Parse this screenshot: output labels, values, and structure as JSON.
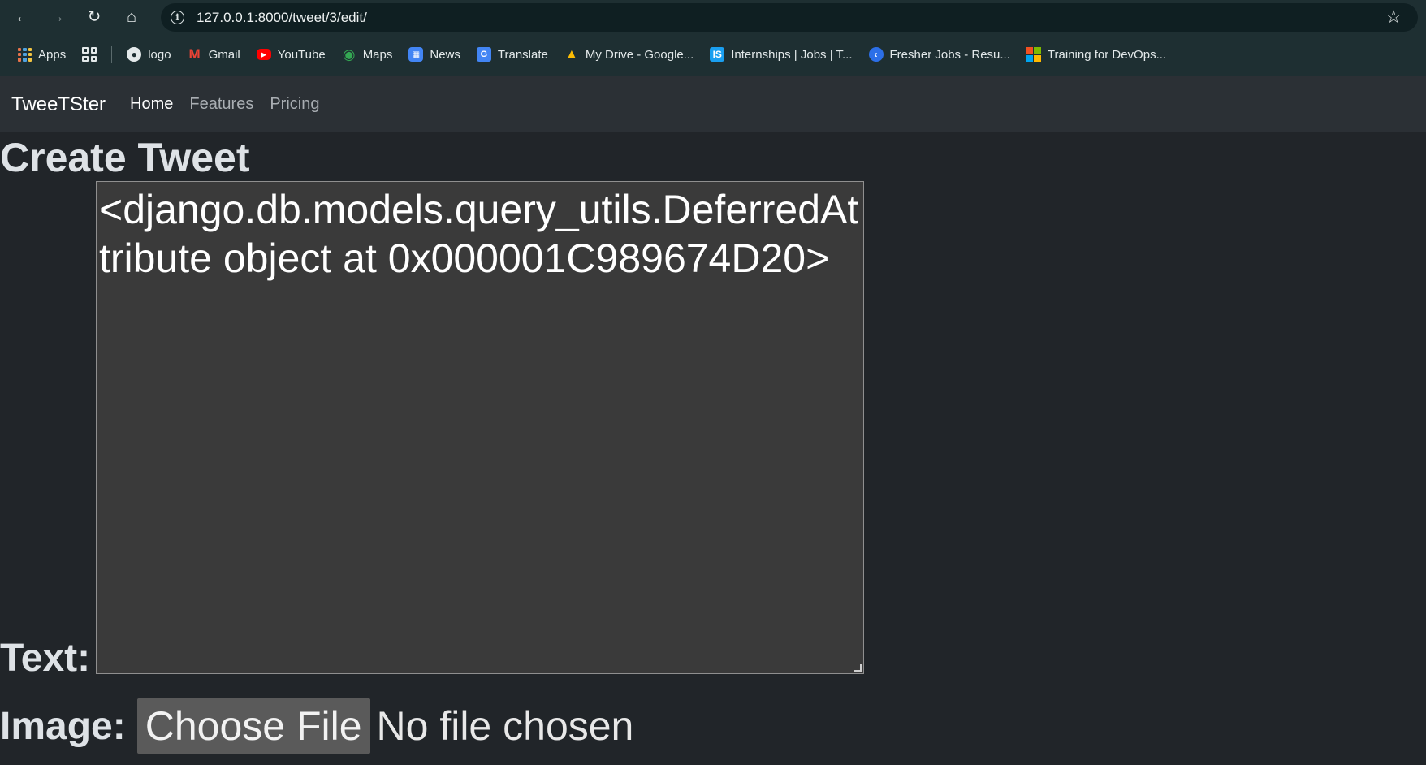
{
  "browser": {
    "url": "127.0.0.1:8000/tweet/3/edit/",
    "bookmarks": [
      {
        "label": "Apps",
        "icon": "apps-grid-icon"
      },
      {
        "label": "logo",
        "icon": "globe-icon"
      },
      {
        "label": "Gmail",
        "icon": "gmail-icon",
        "color": "#ea4335"
      },
      {
        "label": "YouTube",
        "icon": "youtube-icon",
        "color": "#ff0000"
      },
      {
        "label": "Maps",
        "icon": "maps-pin-icon",
        "color": "#34a853"
      },
      {
        "label": "News",
        "icon": "google-news-icon",
        "color": "#4285f4"
      },
      {
        "label": "Translate",
        "icon": "google-translate-icon",
        "color": "#4285f4"
      },
      {
        "label": "My Drive - Google...",
        "icon": "google-drive-icon",
        "color": "#fbbc04"
      },
      {
        "label": "Internships | Jobs | T...",
        "icon": "internshala-icon",
        "color": "#1a9ff0"
      },
      {
        "label": "Fresher Jobs - Resu...",
        "icon": "fresher-jobs-icon",
        "color": "#2c6fe8"
      },
      {
        "label": "Training for DevOps...",
        "icon": "microsoft-logo-icon"
      }
    ]
  },
  "navbar": {
    "brand": "TweeTSter",
    "links": [
      {
        "label": "Home",
        "active": true
      },
      {
        "label": "Features",
        "active": false
      },
      {
        "label": "Pricing",
        "active": false
      }
    ]
  },
  "form": {
    "title": "Create Tweet",
    "text_label": "Text:",
    "text_value": "<django.db.models.query_utils.DeferredAttribute object at 0x000001C989674D20>",
    "image_label": "Image:",
    "choose_file_label": "Choose File",
    "file_status": "No file chosen"
  }
}
